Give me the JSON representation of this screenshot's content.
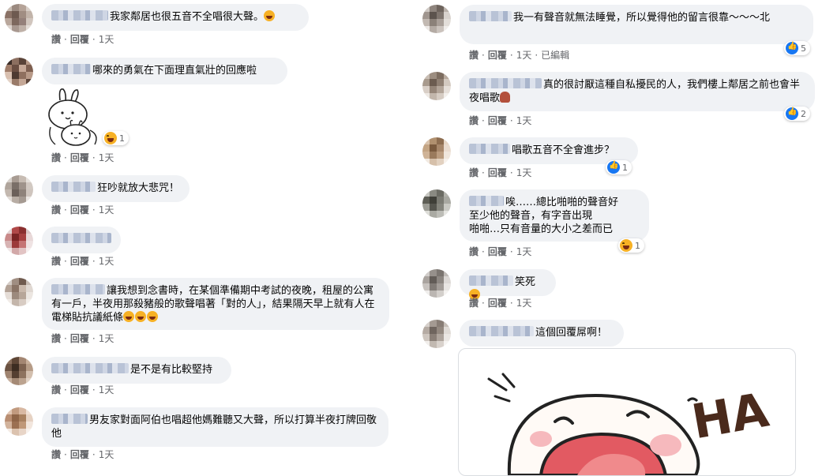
{
  "colors": {
    "bubble": "#f0f2f5",
    "meta": "#65676b",
    "like": "#1877f2",
    "haha": "#f7b125"
  },
  "actions": {
    "like": "讚",
    "reply": "回覆",
    "time": "1天",
    "edited": "已編輯"
  },
  "left_comments": [
    {
      "text": "我家鄰居也很五音不全唱很大聲。",
      "emoji_after": "haha"
    },
    {
      "text": "哪來的勇氣在下面理直氣壯的回應啦",
      "sticker": "rabbit-sticker",
      "reaction": {
        "type": "haha",
        "count": "1"
      }
    },
    {
      "text": "狂吵就放大悲咒！"
    },
    {
      "text": ""
    },
    {
      "text": "讓我想到念書時，在某個準備期中考試的夜晚，租屋的公寓有一戶，半夜用那殺豬般的歌聲唱著「對的人」，結果隔天早上就有人在電梯貼抗議紙條",
      "emoji_after": "haha-x3"
    },
    {
      "text": "是不是有比較堅持"
    },
    {
      "text": "男友家對面阿伯也唱超他媽難聽又大聲，所以打算半夜打牌回敬他"
    }
  ],
  "right_comments": [
    {
      "text": "我一有聲音就無法睡覺，所以覺得他的留言很靠～～～北",
      "edited": true,
      "reaction": {
        "type": "like",
        "count": "5"
      }
    },
    {
      "text": "真的很討厭這種自私擾民的人，我們樓上鄰居之前也會半夜唱歌",
      "emoji_after": "person",
      "reaction": {
        "type": "like",
        "count": "2"
      }
    },
    {
      "text": "唱歌五音不全會進步？",
      "reaction": {
        "type": "like",
        "count": "1"
      }
    },
    {
      "text": "唉……總比啪啪的聲音好\n至少他的聲音，有字音出現\n啪啪…只有音量的大小之差而已",
      "reaction": {
        "type": "haha",
        "count": "1"
      }
    },
    {
      "text": "笑死",
      "emoji_after": "haha"
    },
    {
      "text": "這個回覆屌啊！",
      "sticker": "ha-sticker"
    }
  ],
  "sticker_text": "HA"
}
